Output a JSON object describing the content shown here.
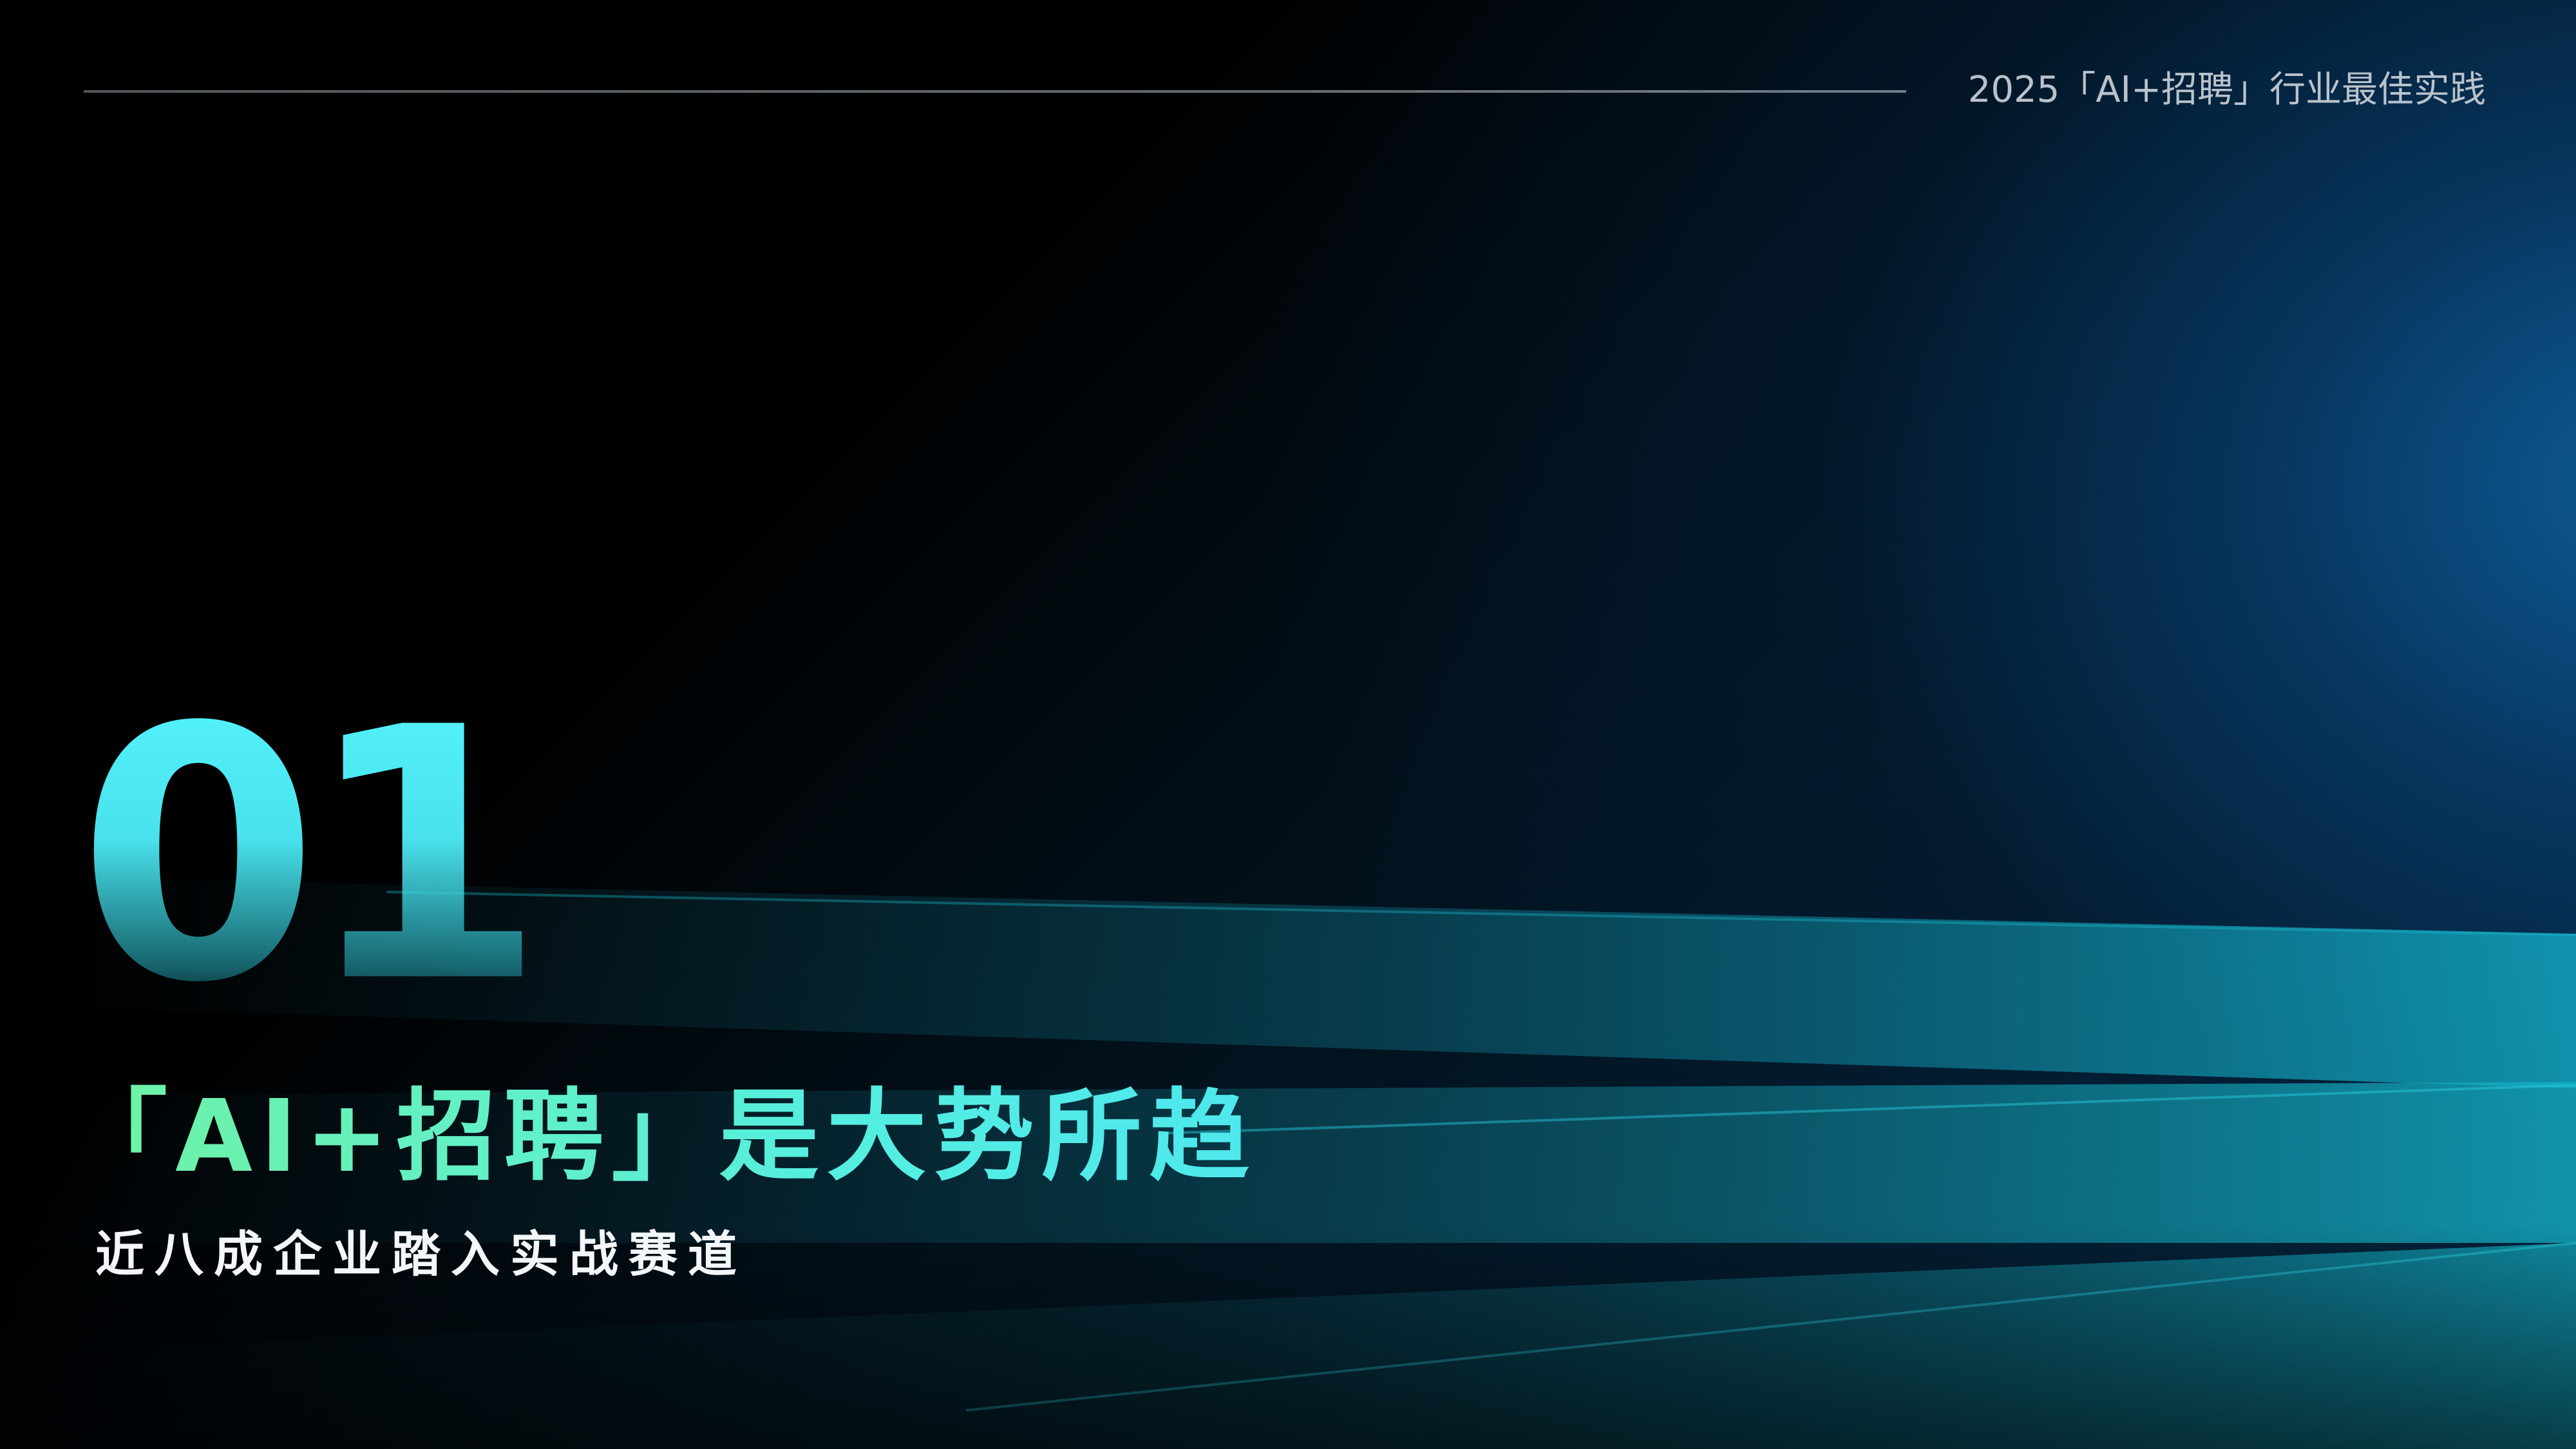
{
  "header": {
    "title": "2025「AI+招聘」行业最佳实践"
  },
  "section": {
    "number": "01",
    "title": "「AI+招聘」是大势所趋",
    "subtitle": "近八成企业踏入实战赛道"
  },
  "colors": {
    "accent_cyan": "#55f4fd",
    "title_gradient_start": "#6ff2a2",
    "title_gradient_end": "#4ee8ee",
    "background_blue": "#0e609e"
  }
}
